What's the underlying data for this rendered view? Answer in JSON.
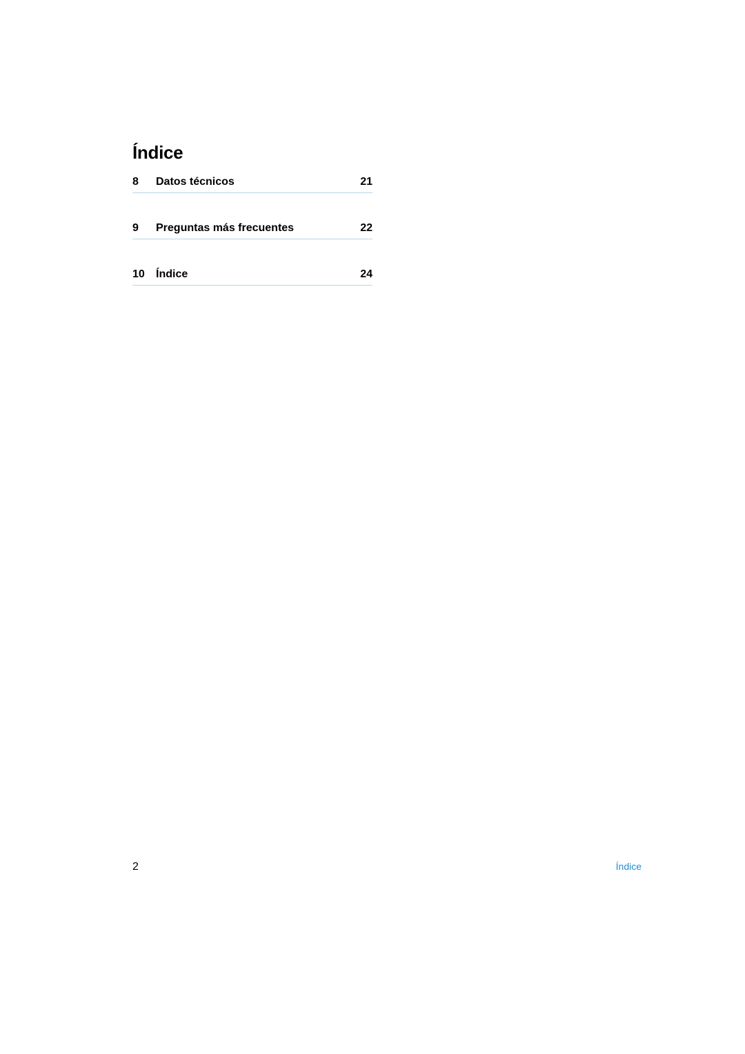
{
  "toc": {
    "title": "Índice",
    "entries": [
      {
        "num": "8",
        "label": "Datos técnicos",
        "page": "21"
      },
      {
        "num": "9",
        "label": "Preguntas más frecuentes",
        "page": "22"
      },
      {
        "num": "10",
        "label": "Índice",
        "page": "24"
      }
    ]
  },
  "footer": {
    "page_number": "2",
    "section_label": "Índice"
  }
}
